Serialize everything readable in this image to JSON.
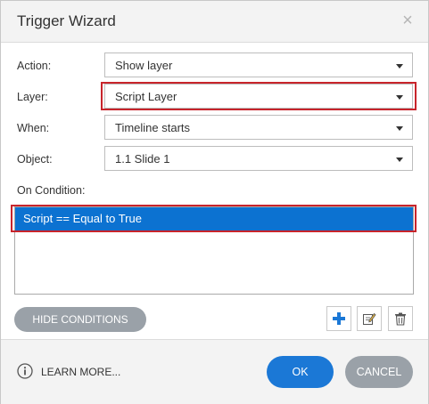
{
  "dialog": {
    "title": "Trigger Wizard",
    "close_icon": "close-icon"
  },
  "fields": {
    "action": {
      "label": "Action:",
      "value": "Show layer"
    },
    "layer": {
      "label": "Layer:",
      "value": "Script Layer"
    },
    "when": {
      "label": "When:",
      "value": "Timeline starts"
    },
    "object": {
      "label": "Object:",
      "value": "1.1 Slide 1"
    }
  },
  "conditions": {
    "label": "On Condition:",
    "items": [
      "Script == Equal to True"
    ],
    "hide_button": "HIDE CONDITIONS",
    "add_icon": "plus-icon",
    "edit_icon": "edit-icon",
    "delete_icon": "trash-icon"
  },
  "footer": {
    "learn_more": "LEARN MORE...",
    "info_icon": "info-icon",
    "ok": "OK",
    "cancel": "CANCEL"
  },
  "colors": {
    "accent": "#1b78d6",
    "highlight": "#c8242b",
    "selected_row": "#0c72d1",
    "secondary_button": "#9aa1a8"
  }
}
